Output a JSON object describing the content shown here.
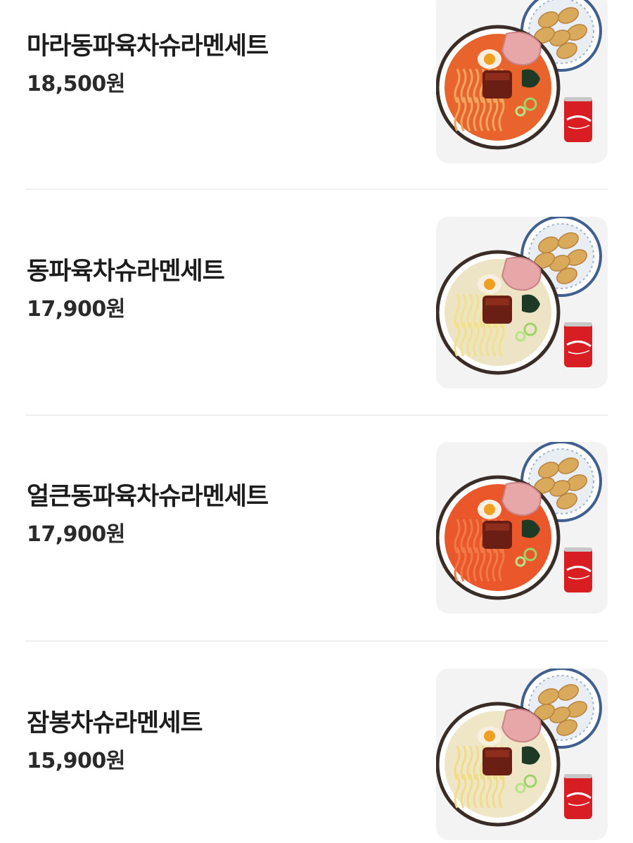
{
  "menu": {
    "items": [
      {
        "name": "마라동파육차슈라멘세트",
        "price": "18,500원",
        "image": "ramen-set-photo",
        "broth": "#e8642c",
        "noodle": "#f0a860"
      },
      {
        "name": "동파육차슈라멘세트",
        "price": "17,900원",
        "image": "ramen-set-photo",
        "broth": "#ece4c4",
        "noodle": "#f3e08a"
      },
      {
        "name": "얼큰동파육차슈라멘세트",
        "price": "17,900원",
        "image": "ramen-set-photo",
        "broth": "#e9572a",
        "noodle": "#f07b48"
      },
      {
        "name": "잠봉차슈라멘세트",
        "price": "15,900원",
        "image": "ramen-set-photo",
        "broth": "#efe6c8",
        "noodle": "#f1dc86"
      }
    ]
  }
}
